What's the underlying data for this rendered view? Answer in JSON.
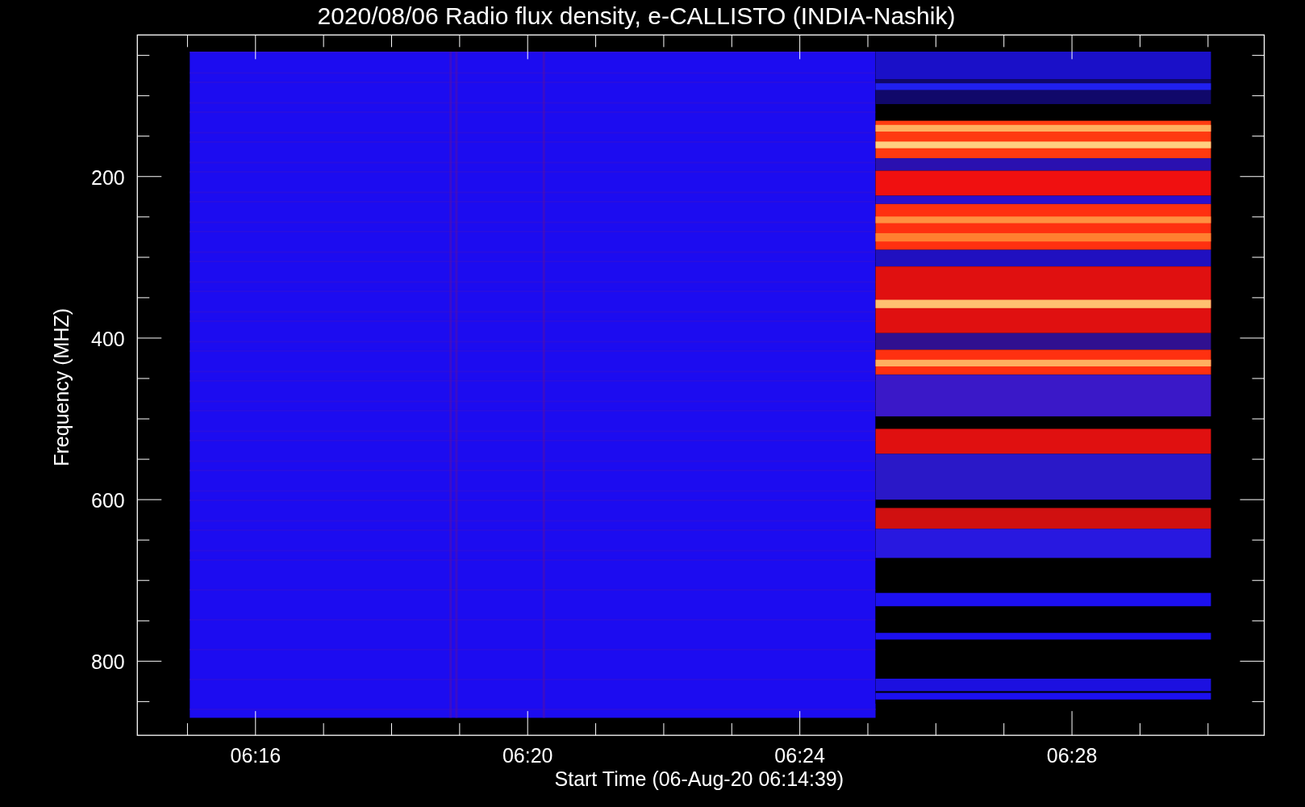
{
  "title": "2020/08/06  Radio flux density, e-CALLISTO (INDIA-Nashik)",
  "y_axis": {
    "label": "Frequency (MHZ)",
    "tick_labels": [
      "200",
      "400",
      "600",
      "800"
    ]
  },
  "x_axis": {
    "label": "Start Time (06-Aug-20 06:14:39)",
    "tick_labels": [
      "06:16",
      "06:20",
      "06:24",
      "06:28"
    ]
  }
}
